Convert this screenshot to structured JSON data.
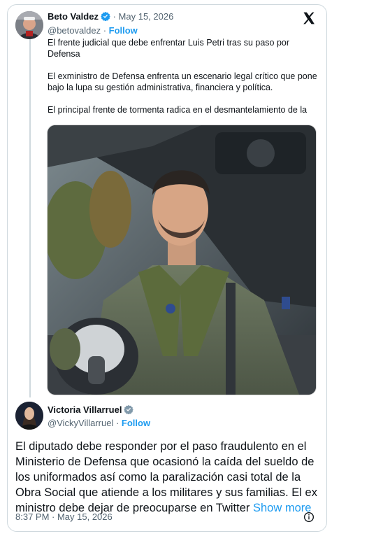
{
  "tweet1": {
    "name": "Beto Valdez",
    "date": "May 15, 2026",
    "handle": "@betovaldez",
    "follow": "Follow",
    "lines": [
      "El frente judicial que  debe enfrentar Luis Petri tras su paso por",
      "Defensa",
      "",
      "El exministro de Defensa enfrenta un escenario legal crítico que pone",
      "bajo la lupa su gestión administrativa, financiera y política.",
      "",
      "El principal frente de tormenta radica en el desmantelamiento de la"
    ]
  },
  "tweet2": {
    "name": "Victoria Villarruel",
    "handle": "@VickyVillarruel",
    "follow": "Follow",
    "lines": [
      "El diputado debe responder por el paso fraudulento en el",
      "Ministerio de Defensa que ocasionó la caída del sueldo de",
      "los uniformados así como la paralización casi total de la",
      "Obra Social que atiende a los militares y sus familias. El ex",
      "ministro debe dejar de preocuparse en Twitter"
    ],
    "show_more": "Show more",
    "time": "8:37 PM · May 15, 2026"
  },
  "icons": {
    "verified": "verified-badge-icon",
    "x_logo": "x-logo-icon",
    "info": "info-icon"
  },
  "colors": {
    "link": "#1d9bf0",
    "muted": "#536471",
    "border": "#cfd9de",
    "verified_gray": "#829aab"
  }
}
